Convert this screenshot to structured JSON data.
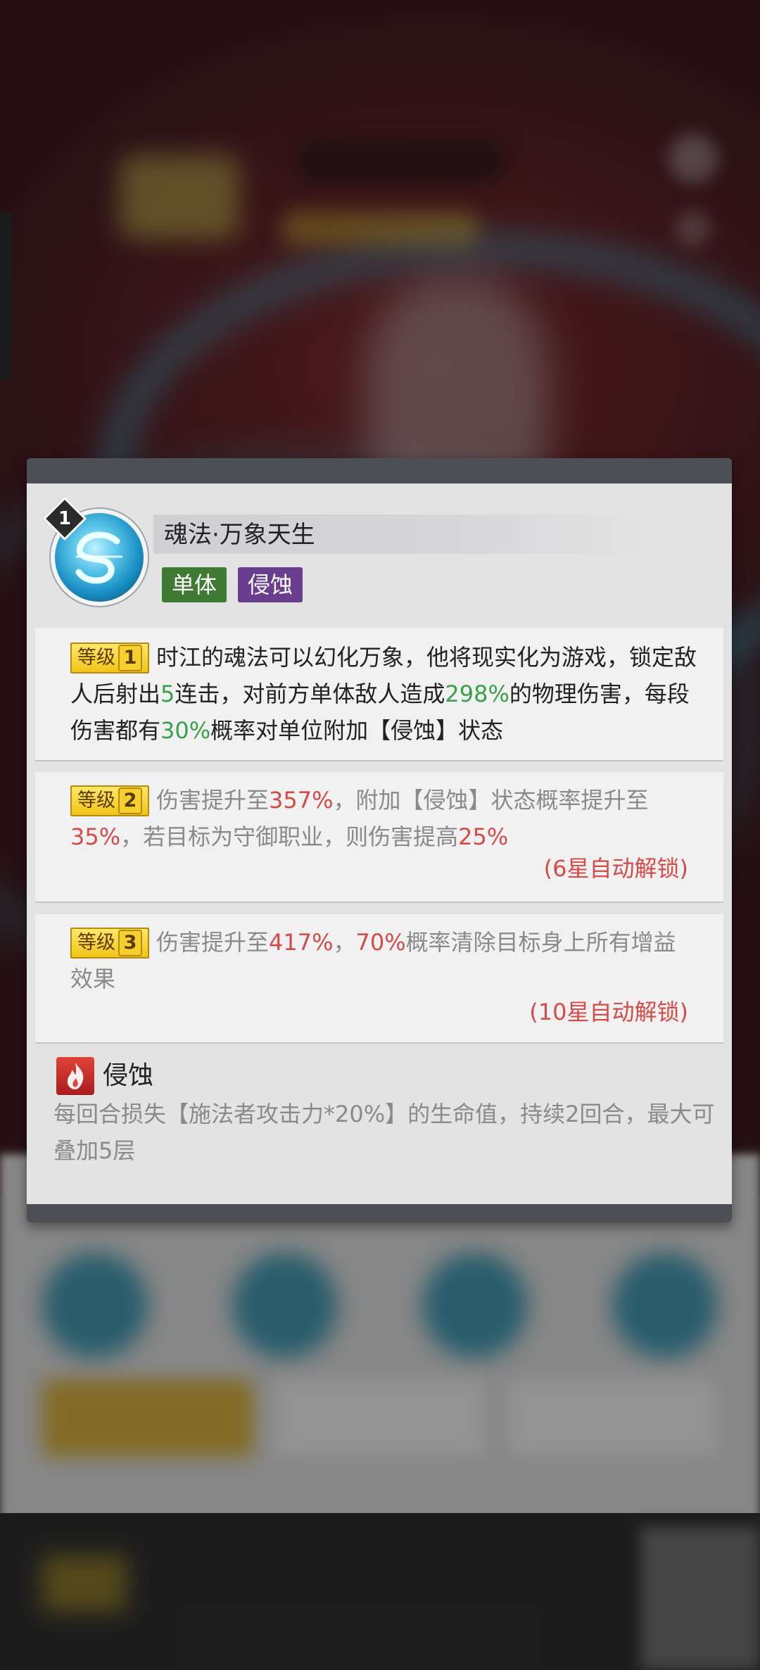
{
  "skill": {
    "level_number": "1",
    "name": "魂法·万象天生",
    "tags": [
      "单体",
      "侵蚀"
    ],
    "icon": "swirl-skill-icon"
  },
  "levels": [
    {
      "badge": "等级",
      "badge_num": "1",
      "segments": [
        {
          "text": "时江的魂法可以幻化万象，他将现实化为游戏，锁定敌人后射出",
          "style": "normal"
        },
        {
          "text": "5",
          "style": "green"
        },
        {
          "text": "连击，对前方单体敌人造成",
          "style": "normal"
        },
        {
          "text": "298%",
          "style": "green"
        },
        {
          "text": "的物理伤害，每段伤害都有",
          "style": "normal"
        },
        {
          "text": "30%",
          "style": "green"
        },
        {
          "text": "概率对单位附加【侵蚀】状态",
          "style": "normal"
        }
      ],
      "unlock": ""
    },
    {
      "badge": "等级",
      "badge_num": "2",
      "segments": [
        {
          "text": "伤害提升至",
          "style": "normal"
        },
        {
          "text": "357%",
          "style": "red"
        },
        {
          "text": "，附加【侵蚀】状态概率提升至",
          "style": "normal"
        },
        {
          "text": "35%",
          "style": "red"
        },
        {
          "text": "，若目标为守御职业，则伤害提高",
          "style": "normal"
        },
        {
          "text": "25%",
          "style": "red"
        }
      ],
      "unlock": "(6星自动解锁)"
    },
    {
      "badge": "等级",
      "badge_num": "3",
      "segments": [
        {
          "text": "伤害提升至",
          "style": "normal"
        },
        {
          "text": "417%",
          "style": "red"
        },
        {
          "text": "，",
          "style": "normal"
        },
        {
          "text": "70%",
          "style": "red"
        },
        {
          "text": "概率清除目标身上所有增益效果",
          "style": "normal"
        }
      ],
      "unlock": "(10星自动解锁)"
    }
  ],
  "effect": {
    "icon": "flame-icon",
    "name": "侵蚀",
    "description": "每回合损失【施法者攻击力*20%】的生命值，持续2回合，最大可叠加5层"
  },
  "colors": {
    "green": "#3aa04a",
    "red": "#d44b47",
    "tag_single": "#3f7a33",
    "tag_corrode": "#6a3e8f",
    "panel": "#e3e3e3"
  }
}
